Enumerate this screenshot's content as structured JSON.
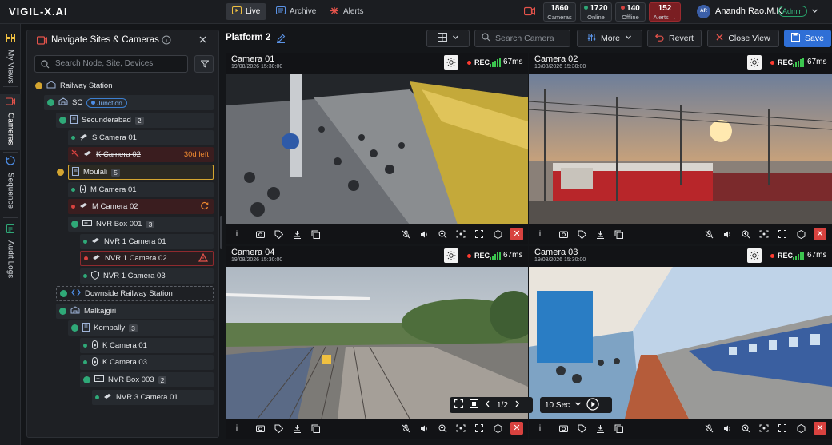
{
  "app": {
    "logo": "VIGIL-X.AI"
  },
  "nav": {
    "tabs": [
      {
        "label": "Live"
      },
      {
        "label": "Archive"
      },
      {
        "label": "Alerts"
      }
    ]
  },
  "stats": {
    "cameras": {
      "value": "1860",
      "label": "Cameras"
    },
    "online": {
      "value": "1720",
      "label": "Online"
    },
    "offline": {
      "value": "140",
      "label": "Offline"
    },
    "alerts": {
      "value": "152",
      "label": "Alerts →"
    }
  },
  "user": {
    "initials": "AR",
    "name": "Anandh Rao.M.K",
    "role": "Admin"
  },
  "rail": {
    "items": [
      {
        "label": "My Views"
      },
      {
        "label": "Cameras"
      },
      {
        "label": "Sequence"
      },
      {
        "label": "Audit Logs"
      }
    ]
  },
  "panel": {
    "title": "Navigate Sites & Cameras",
    "search_placeholder": "Search Node, Site, Devices",
    "tree": [
      {
        "label": "Railway Station"
      },
      {
        "label": "SC",
        "badge": "Junction"
      },
      {
        "label": "Secunderabad",
        "count": "2"
      },
      {
        "label": "S Camera 01"
      },
      {
        "label": "K Camera 02",
        "note": "30d left"
      },
      {
        "label": "Moulali",
        "count": "5"
      },
      {
        "label": "M Camera 01"
      },
      {
        "label": "M Camera 02"
      },
      {
        "label": "NVR Box 001",
        "count": "3"
      },
      {
        "label": "NVR 1 Camera 01"
      },
      {
        "label": "NVR 1 Camera 02"
      },
      {
        "label": "NVR 1 Camera 03"
      },
      {
        "label": "Downside Railway Station"
      },
      {
        "label": "Malkajgiri"
      },
      {
        "label": "Kompally",
        "count": "3"
      },
      {
        "label": "K Camera 01"
      },
      {
        "label": "K Camera 03"
      },
      {
        "label": "NVR Box 003",
        "count": "2"
      },
      {
        "label": "NVR 3 Camera 01"
      }
    ]
  },
  "toolbar": {
    "view_name": "Platform 2",
    "search_placeholder": "Search Camera",
    "more_label": "More",
    "revert_label": "Revert",
    "close_view_label": "Close View",
    "save_label": "Save"
  },
  "tiles": [
    {
      "name": "Camera 01",
      "date": "19/08/2026 15:30:00",
      "rec": "REC",
      "latency": "67ms"
    },
    {
      "name": "Camera 02",
      "date": "19/08/2026 15:30:00",
      "rec": "REC",
      "latency": "67ms"
    },
    {
      "name": "Camera 04",
      "date": "19/08/2026 15:30:00",
      "rec": "REC",
      "latency": "67ms"
    },
    {
      "name": "Camera 03",
      "date": "19/08/2026 15:30:00",
      "rec": "REC",
      "latency": "67ms"
    }
  ],
  "pager": {
    "label": "1/2"
  },
  "sequence": {
    "interval": "10 Sec"
  },
  "colors": {
    "accent": "#2f6fd6",
    "online": "#2fa978",
    "offline": "#d8423f",
    "warning": "#d4a530",
    "rec": "#ff3b30",
    "signal": "#3cc64f"
  }
}
